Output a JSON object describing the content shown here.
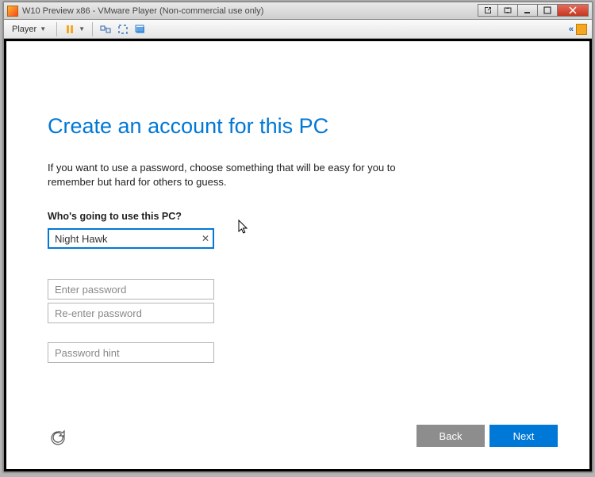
{
  "window": {
    "title": "W10 Preview x86 - VMware Player (Non-commercial use only)"
  },
  "toolbar": {
    "player_label": "Player"
  },
  "oobe": {
    "heading": "Create an account for this PC",
    "description": "If you want to use a password, choose something that will be easy for you to remember but hard for others to guess.",
    "user_label": "Who's going to use this PC?",
    "username_value": "Night Hawk",
    "password_placeholder": "Enter password",
    "password_confirm_placeholder": "Re-enter password",
    "hint_placeholder": "Password hint",
    "buttons": {
      "back": "Back",
      "next": "Next"
    }
  }
}
